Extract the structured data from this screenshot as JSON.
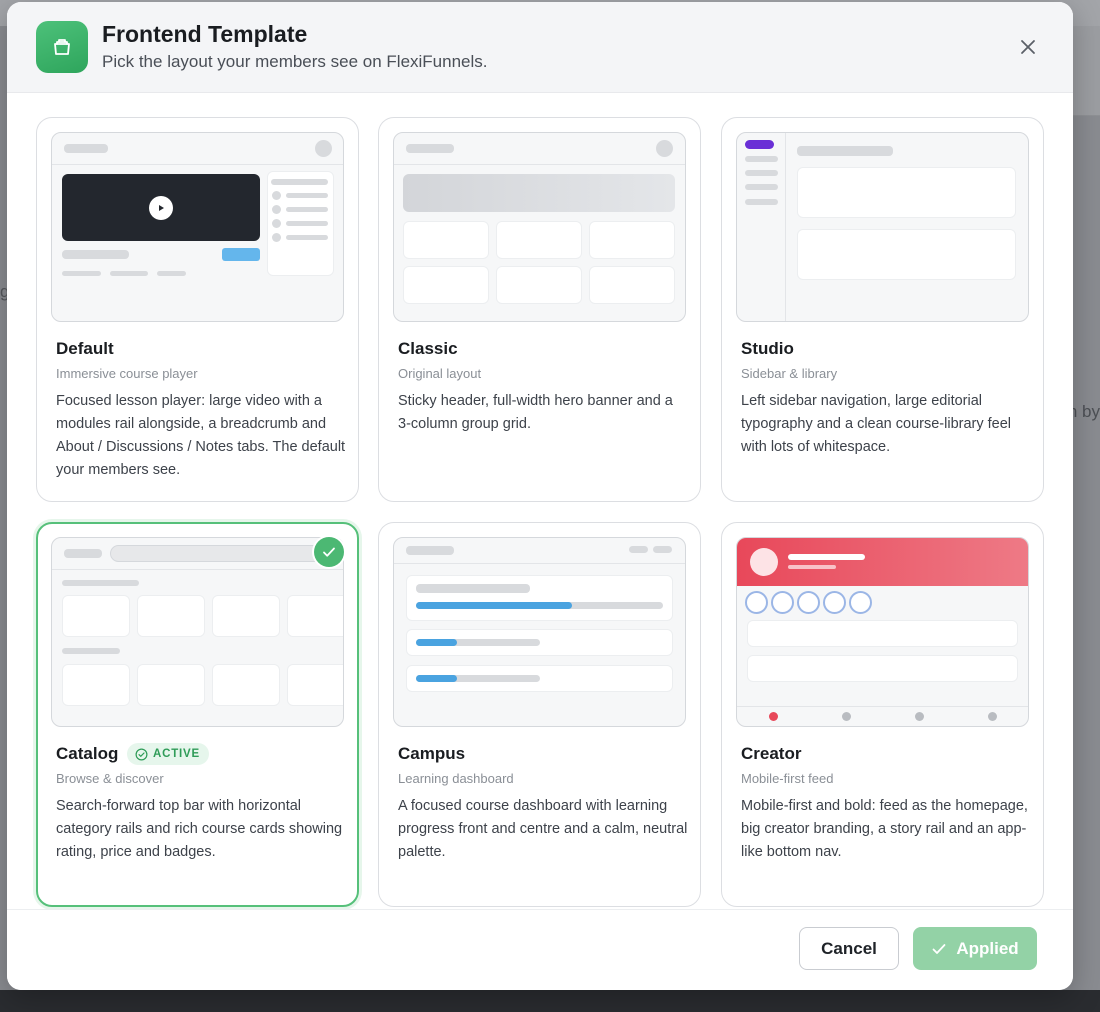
{
  "header": {
    "title": "Frontend Template",
    "subtitle": "Pick the layout your members see on FlexiFunnels."
  },
  "background": {
    "right_fragment": "h by",
    "left_fragment": "g"
  },
  "templates": [
    {
      "name": "Default",
      "tag": "Immersive course player",
      "description": "Focused lesson player: large video with a modules rail alongside, a breadcrumb and About / Discussions / Notes tabs. The default your members see.",
      "active": false
    },
    {
      "name": "Classic",
      "tag": "Original layout",
      "description": "Sticky header, full-width hero banner and a 3-column group grid.",
      "active": false
    },
    {
      "name": "Studio",
      "tag": "Sidebar & library",
      "description": "Left sidebar navigation, large editorial typography and a clean course-library feel with lots of whitespace.",
      "active": false
    },
    {
      "name": "Catalog",
      "tag": "Browse & discover",
      "description": "Search-forward top bar with horizontal category rails and rich course cards showing rating, price and badges.",
      "active": true
    },
    {
      "name": "Campus",
      "tag": "Learning dashboard",
      "description": "A focused course dashboard with learning progress front and centre and a calm, neutral palette.",
      "active": false
    },
    {
      "name": "Creator",
      "tag": "Mobile-first feed",
      "description": "Mobile-first and bold: feed as the homepage, big creator branding, a story rail and an app-like bottom nav.",
      "active": false
    }
  ],
  "active_badge": "ACTIVE",
  "campus_progress": [
    0.63,
    0.33,
    0.33
  ],
  "footer": {
    "cancel_label": "Cancel",
    "applied_label": "Applied"
  },
  "colors": {
    "accent_green": "#4cb873",
    "applied_button": "#93d2a6",
    "studio_purple": "#6a2fd6",
    "creator_red": "#e8485a",
    "progress_blue": "#4aa3e0"
  }
}
